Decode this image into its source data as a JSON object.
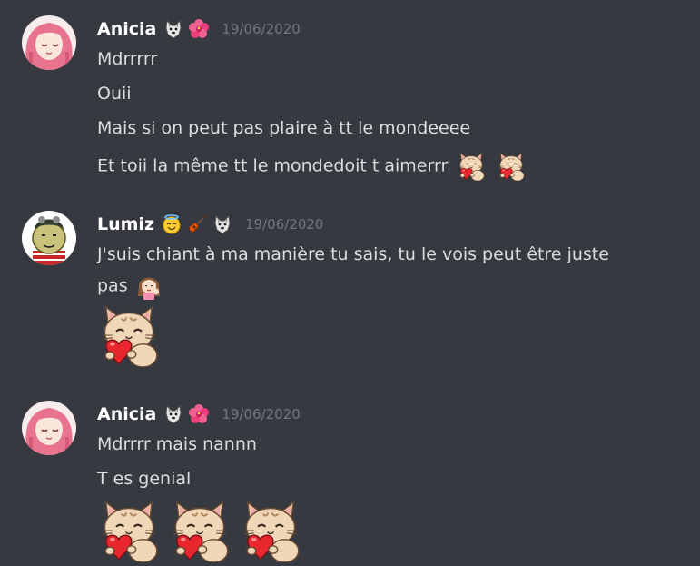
{
  "messages": [
    {
      "author": "Anicia",
      "timestamp": "19/06/2020",
      "badges": [
        "wolf-icon",
        "hibiscus-icon"
      ],
      "lines": [
        "Mdrrrrr",
        "Ouii",
        "Mais si on peut pas plaire à tt le mondeeee",
        "Et toii la même tt le mondedoit t aimerrr"
      ],
      "trailing_emotes": [
        "cat-heart-emote",
        "cat-heart-emote"
      ]
    },
    {
      "author": "Lumiz",
      "timestamp": "19/06/2020",
      "badges": [
        "angel-face-icon",
        "guitar-icon",
        "wolf-icon"
      ],
      "lines": [
        "J'suis chiant à ma manière tu sais, tu le vois peut être juste",
        "pas"
      ],
      "inline_emote": "anime-girl-wave-emote",
      "big_emotes": [
        "cat-heart-emote"
      ]
    },
    {
      "author": "Anicia",
      "timestamp": "19/06/2020",
      "badges": [
        "wolf-icon",
        "hibiscus-icon"
      ],
      "lines": [
        "Mdrrrr mais nannn",
        "T es genial"
      ],
      "big_emotes": [
        "cat-heart-emote",
        "cat-heart-emote",
        "cat-heart-emote"
      ]
    }
  ],
  "colors": {
    "background": "#36393f",
    "username": "#ffffff",
    "text": "#dcddde",
    "timestamp": "#72767d"
  }
}
